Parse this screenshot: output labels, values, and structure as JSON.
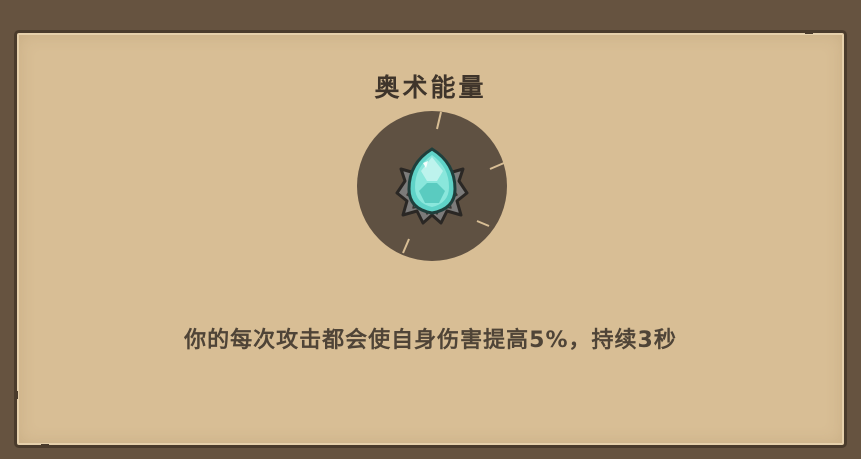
{
  "skill": {
    "name": "奥术能量",
    "description": "你的每次攻击都会使自身伤害提高5%，持续3秒",
    "icon": "cyan-gem-icon"
  },
  "colors": {
    "background": "#665340",
    "panel": "#d8be95",
    "panel_border": "#4a3b2c",
    "icon_disc": "#5f5142",
    "gem": "#5fd3c8",
    "title_text": "#3f352b",
    "desc_text": "#4f4437"
  }
}
